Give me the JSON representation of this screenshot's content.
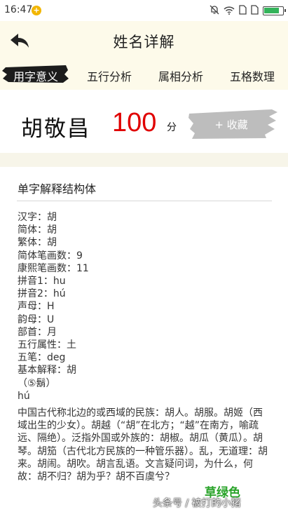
{
  "status": {
    "time": "16:47",
    "notif_badge": "+"
  },
  "header": {
    "title": "姓名详解"
  },
  "tabs": [
    {
      "label": "用字意义",
      "active": true
    },
    {
      "label": "五行分析",
      "active": false
    },
    {
      "label": "属相分析",
      "active": false
    },
    {
      "label": "五格数理",
      "active": false
    }
  ],
  "name_card": {
    "name": "胡敬昌",
    "score": "100",
    "score_unit": "分",
    "fav_label": "+ 收藏"
  },
  "detail": {
    "title": "单字解释结构体",
    "lines": [
      "汉字：胡",
      "简体：胡",
      "繁体：胡",
      "简体笔画数：9",
      "康熙笔画数：11",
      "拼音1：hu",
      "拼音2：hú",
      "声母：H",
      "韵母：U",
      "部首：月",
      "五行属性：土",
      "五笔：deg",
      "基本解释：胡",
      "（⑤鬍）",
      "hú"
    ],
    "paragraph": "中国古代称北边的或西域的民族：胡人。胡服。胡姬（西域出生的少女）。胡越（“胡”在北方；“越”在南方，喻疏远、隔绝）。泛指外国或外族的：胡椒。胡瓜（黄瓜）。胡琴。胡笳（古代北方民族的一种管乐器）。乱，无道理：胡来。胡闹。胡吹。胡言乱语。文言疑问词，为什么，何故：胡不归？胡为乎？胡不百虞兮？"
  },
  "watermark": {
    "brand": "草绿色",
    "text": "头条号 / 被打的小猪"
  },
  "colors": {
    "score": "#e00000",
    "brand_green": "#29a329",
    "background": "#f7f5e9"
  }
}
